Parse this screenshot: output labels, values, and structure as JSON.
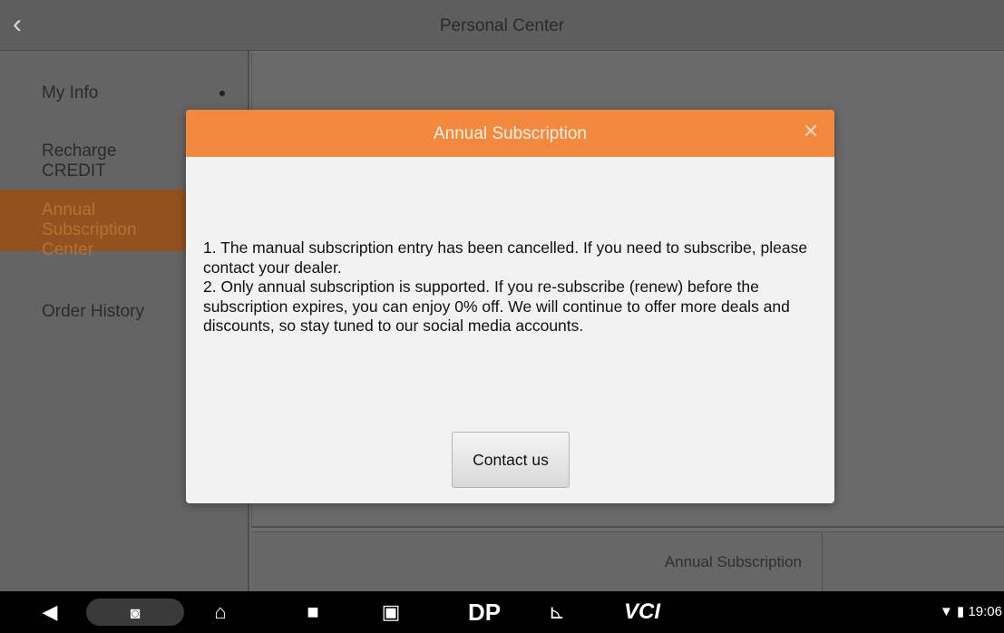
{
  "header": {
    "back_glyph": "‹",
    "title": "Personal Center"
  },
  "sidebar": {
    "items": [
      {
        "label": "My Info"
      },
      {
        "label": "Recharge CREDIT"
      },
      {
        "label": "Annual Subscription Center"
      },
      {
        "label": "Order History"
      }
    ]
  },
  "table": {
    "plan_cell": "Annual Subscription"
  },
  "dialog": {
    "title": "Annual Subscription",
    "close_glyph": "✕",
    "paragraph_1": "1. The manual subscription entry has been cancelled. If you need to subscribe, please contact your dealer.",
    "paragraph_2": "2. Only annual subscription is supported. If you re-subscribe (renew) before the subscription expires, you can enjoy 0% off. We will continue to offer more deals and discounts, so stay tuned to our social media accounts.",
    "contact_button": "Contact us"
  },
  "navbar": {
    "back_icon": "◀",
    "screenshot_icon": "◙",
    "home_icon": "⌂",
    "recent_icon": "■",
    "app1_icon": "▣",
    "app2_label": "DP",
    "app3_icon": "⊾",
    "app4_label": "VCI",
    "time": "19:06",
    "status_icons": "▼ ▮"
  },
  "colors": {
    "dialog_header": "#f3883f",
    "active_sidebar": "#93511f"
  }
}
